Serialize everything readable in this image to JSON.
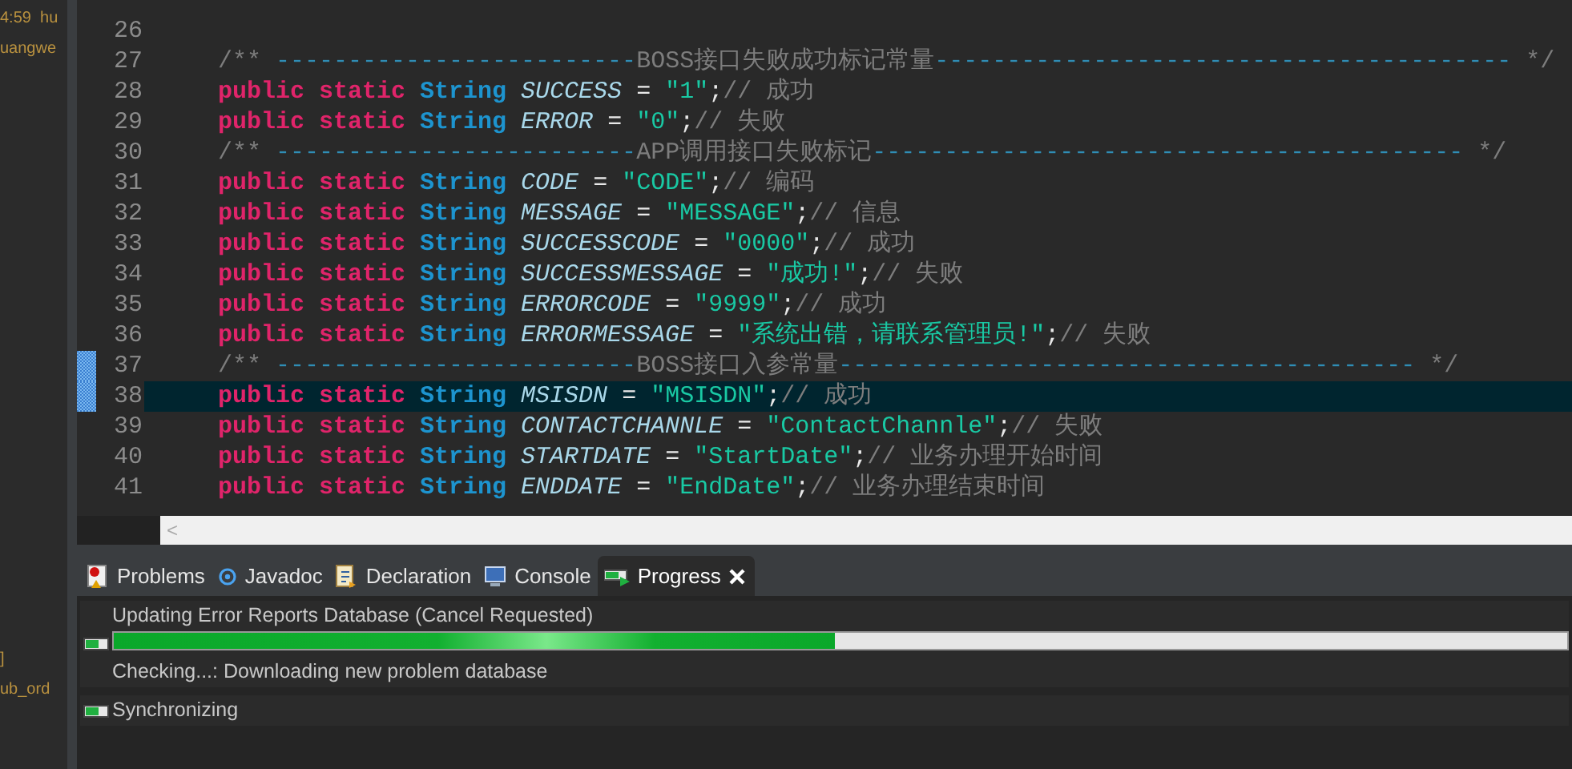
{
  "left_panel": {
    "top_lines": [
      "4:59  hu",
      "uangwe"
    ],
    "bottom_lines": [
      "]",
      "ub_ord"
    ]
  },
  "editor": {
    "lines": [
      {
        "number": "26",
        "marked": false,
        "current": false
      },
      {
        "number": "27",
        "marked": false,
        "current": false,
        "tokens": [
          {
            "kind": "comment",
            "text": "    /** "
          },
          {
            "kind": "dash",
            "text": "-------------------------"
          },
          {
            "kind": "comment",
            "text": "BOSS接口失败成功标记常量"
          },
          {
            "kind": "dash",
            "text": "----------------------------------------"
          },
          {
            "kind": "comment",
            "text": " */"
          }
        ]
      },
      {
        "number": "28",
        "marked": false,
        "current": false,
        "tokens": [
          {
            "kind": "keyword",
            "text": "    public static "
          },
          {
            "kind": "type",
            "text": "String "
          },
          {
            "kind": "field",
            "text": "SUCCESS"
          },
          {
            "kind": "punct",
            "text": " = "
          },
          {
            "kind": "string",
            "text": "\"1\""
          },
          {
            "kind": "punct",
            "text": ";"
          },
          {
            "kind": "comment",
            "text": "// 成功"
          }
        ]
      },
      {
        "number": "29",
        "marked": false,
        "current": false,
        "tokens": [
          {
            "kind": "keyword",
            "text": "    public static "
          },
          {
            "kind": "type",
            "text": "String "
          },
          {
            "kind": "field",
            "text": "ERROR"
          },
          {
            "kind": "punct",
            "text": " = "
          },
          {
            "kind": "string",
            "text": "\"0\""
          },
          {
            "kind": "punct",
            "text": ";"
          },
          {
            "kind": "comment",
            "text": "// 失败"
          }
        ]
      },
      {
        "number": "30",
        "marked": false,
        "current": false,
        "tokens": [
          {
            "kind": "comment",
            "text": "    /** "
          },
          {
            "kind": "dash",
            "text": "-------------------------"
          },
          {
            "kind": "comment",
            "text": "APP调用接口失败标记"
          },
          {
            "kind": "dash",
            "text": "-----------------------------------------"
          },
          {
            "kind": "comment",
            "text": " */"
          }
        ]
      },
      {
        "number": "31",
        "marked": false,
        "current": false,
        "tokens": [
          {
            "kind": "keyword",
            "text": "    public static "
          },
          {
            "kind": "type",
            "text": "String "
          },
          {
            "kind": "field",
            "text": "CODE"
          },
          {
            "kind": "punct",
            "text": " = "
          },
          {
            "kind": "string",
            "text": "\"CODE\""
          },
          {
            "kind": "punct",
            "text": ";"
          },
          {
            "kind": "comment",
            "text": "// 编码"
          }
        ]
      },
      {
        "number": "32",
        "marked": false,
        "current": false,
        "tokens": [
          {
            "kind": "keyword",
            "text": "    public static "
          },
          {
            "kind": "type",
            "text": "String "
          },
          {
            "kind": "field",
            "text": "MESSAGE"
          },
          {
            "kind": "punct",
            "text": " = "
          },
          {
            "kind": "string",
            "text": "\"MESSAGE\""
          },
          {
            "kind": "punct",
            "text": ";"
          },
          {
            "kind": "comment",
            "text": "// 信息"
          }
        ]
      },
      {
        "number": "33",
        "marked": false,
        "current": false,
        "tokens": [
          {
            "kind": "keyword",
            "text": "    public static "
          },
          {
            "kind": "type",
            "text": "String "
          },
          {
            "kind": "field",
            "text": "SUCCESSCODE"
          },
          {
            "kind": "punct",
            "text": " = "
          },
          {
            "kind": "string",
            "text": "\"0000\""
          },
          {
            "kind": "punct",
            "text": ";"
          },
          {
            "kind": "comment",
            "text": "// 成功"
          }
        ]
      },
      {
        "number": "34",
        "marked": false,
        "current": false,
        "tokens": [
          {
            "kind": "keyword",
            "text": "    public static "
          },
          {
            "kind": "type",
            "text": "String "
          },
          {
            "kind": "field",
            "text": "SUCCESSMESSAGE"
          },
          {
            "kind": "punct",
            "text": " = "
          },
          {
            "kind": "string",
            "text": "\"成功!\""
          },
          {
            "kind": "punct",
            "text": ";"
          },
          {
            "kind": "comment",
            "text": "// 失败"
          }
        ]
      },
      {
        "number": "35",
        "marked": false,
        "current": false,
        "tokens": [
          {
            "kind": "keyword",
            "text": "    public static "
          },
          {
            "kind": "type",
            "text": "String "
          },
          {
            "kind": "field",
            "text": "ERRORCODE"
          },
          {
            "kind": "punct",
            "text": " = "
          },
          {
            "kind": "string",
            "text": "\"9999\""
          },
          {
            "kind": "punct",
            "text": ";"
          },
          {
            "kind": "comment",
            "text": "// 成功"
          }
        ]
      },
      {
        "number": "36",
        "marked": false,
        "current": false,
        "tokens": [
          {
            "kind": "keyword",
            "text": "    public static "
          },
          {
            "kind": "type",
            "text": "String "
          },
          {
            "kind": "field",
            "text": "ERRORMESSAGE"
          },
          {
            "kind": "punct",
            "text": " = "
          },
          {
            "kind": "string",
            "text": "\"系统出错，请联系管理员!\""
          },
          {
            "kind": "punct",
            "text": ";"
          },
          {
            "kind": "comment",
            "text": "// 失败"
          }
        ]
      },
      {
        "number": "37",
        "marked": true,
        "current": false,
        "tokens": [
          {
            "kind": "comment",
            "text": "    /** "
          },
          {
            "kind": "dash",
            "text": "-------------------------"
          },
          {
            "kind": "comment",
            "text": "BOSS接口入参常量"
          },
          {
            "kind": "dash",
            "text": "----------------------------------------"
          },
          {
            "kind": "comment",
            "text": " */"
          }
        ]
      },
      {
        "number": "38",
        "marked": true,
        "current": true,
        "tokens": [
          {
            "kind": "keyword",
            "text": "    public static "
          },
          {
            "kind": "type",
            "text": "String "
          },
          {
            "kind": "field",
            "text": "MSISDN"
          },
          {
            "kind": "punct",
            "text": " = "
          },
          {
            "kind": "string",
            "text": "\"MSISDN\""
          },
          {
            "kind": "punct",
            "text": ";"
          },
          {
            "kind": "comment",
            "text": "// 成功"
          }
        ]
      },
      {
        "number": "39",
        "marked": false,
        "current": false,
        "tokens": [
          {
            "kind": "keyword",
            "text": "    public static "
          },
          {
            "kind": "type",
            "text": "String "
          },
          {
            "kind": "field",
            "text": "CONTACTCHANNLE"
          },
          {
            "kind": "punct",
            "text": " = "
          },
          {
            "kind": "string",
            "text": "\"ContactChannle\""
          },
          {
            "kind": "punct",
            "text": ";"
          },
          {
            "kind": "comment",
            "text": "// 失败"
          }
        ]
      },
      {
        "number": "40",
        "marked": false,
        "current": false,
        "tokens": [
          {
            "kind": "keyword",
            "text": "    public static "
          },
          {
            "kind": "type",
            "text": "String "
          },
          {
            "kind": "field",
            "text": "STARTDATE"
          },
          {
            "kind": "punct",
            "text": " = "
          },
          {
            "kind": "string",
            "text": "\"StartDate\""
          },
          {
            "kind": "punct",
            "text": ";"
          },
          {
            "kind": "comment",
            "text": "// 业务办理开始时间"
          }
        ]
      },
      {
        "number": "41",
        "marked": false,
        "current": false,
        "tokens": [
          {
            "kind": "keyword",
            "text": "    public static "
          },
          {
            "kind": "type",
            "text": "String "
          },
          {
            "kind": "field",
            "text": "ENDDATE"
          },
          {
            "kind": "punct",
            "text": " = "
          },
          {
            "kind": "string",
            "text": "\"EndDate\""
          },
          {
            "kind": "punct",
            "text": ";"
          },
          {
            "kind": "comment",
            "text": "// 业务办理结束时间"
          }
        ]
      }
    ],
    "scroll_left": "<"
  },
  "tabs": [
    {
      "label": "Problems",
      "kind": "problems",
      "selected": false
    },
    {
      "label": "Javadoc",
      "kind": "javadoc",
      "selected": false
    },
    {
      "label": "Declaration",
      "kind": "declaration",
      "selected": false
    },
    {
      "label": "Console",
      "kind": "console",
      "selected": false
    },
    {
      "label": "Progress",
      "kind": "progress",
      "selected": true
    }
  ],
  "progress": [
    {
      "title": "Updating Error Reports Database (Cancel Requested)",
      "level": 0.496,
      "detail": "Checking...: Downloading new problem database"
    },
    {
      "title": "Synchronizing"
    }
  ]
}
